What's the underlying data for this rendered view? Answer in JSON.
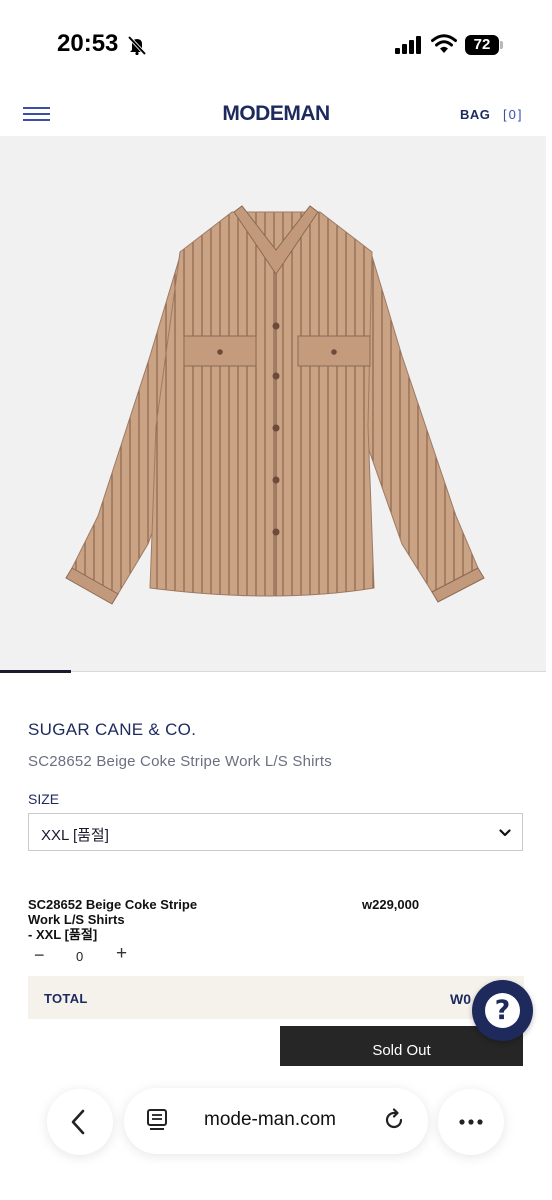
{
  "status_bar": {
    "time": "20:53",
    "battery": "72"
  },
  "header": {
    "logo": "MODEMAN",
    "bag_label": "BAG",
    "bag_count": "[0]"
  },
  "gallery": {
    "slide_progress": 0.13
  },
  "product": {
    "brand": "SUGAR CANE & CO.",
    "title": "SC28652 Beige Coke Stripe Work L/S Shirts",
    "size_label": "SIZE",
    "size_selected": "XXL [품절]"
  },
  "line_item": {
    "name_line1": "SC28652 Beige Coke Stripe",
    "name_line2": "Work L/S Shirts",
    "name_line3": "- XXL [품절]",
    "price": "w229,000",
    "quantity": "0",
    "minus_symbol": "−",
    "plus_symbol": "+"
  },
  "total": {
    "label": "TOTAL",
    "value": "W0"
  },
  "help": {
    "symbol": "?"
  },
  "cta": {
    "label": "Sold Out"
  },
  "browser": {
    "url": "mode-man.com"
  },
  "colors": {
    "brand": "#1d2a5e",
    "accent": "#3a4fa8",
    "shirt": "#c9a384",
    "help_bg": "#1f2a5c"
  },
  "icons": [
    "bell-slash-icon",
    "signal-icon",
    "wifi-icon",
    "battery-icon",
    "menu-icon",
    "chevron-down-icon",
    "help-icon",
    "back-icon",
    "reader-icon",
    "reload-icon",
    "more-icon"
  ]
}
